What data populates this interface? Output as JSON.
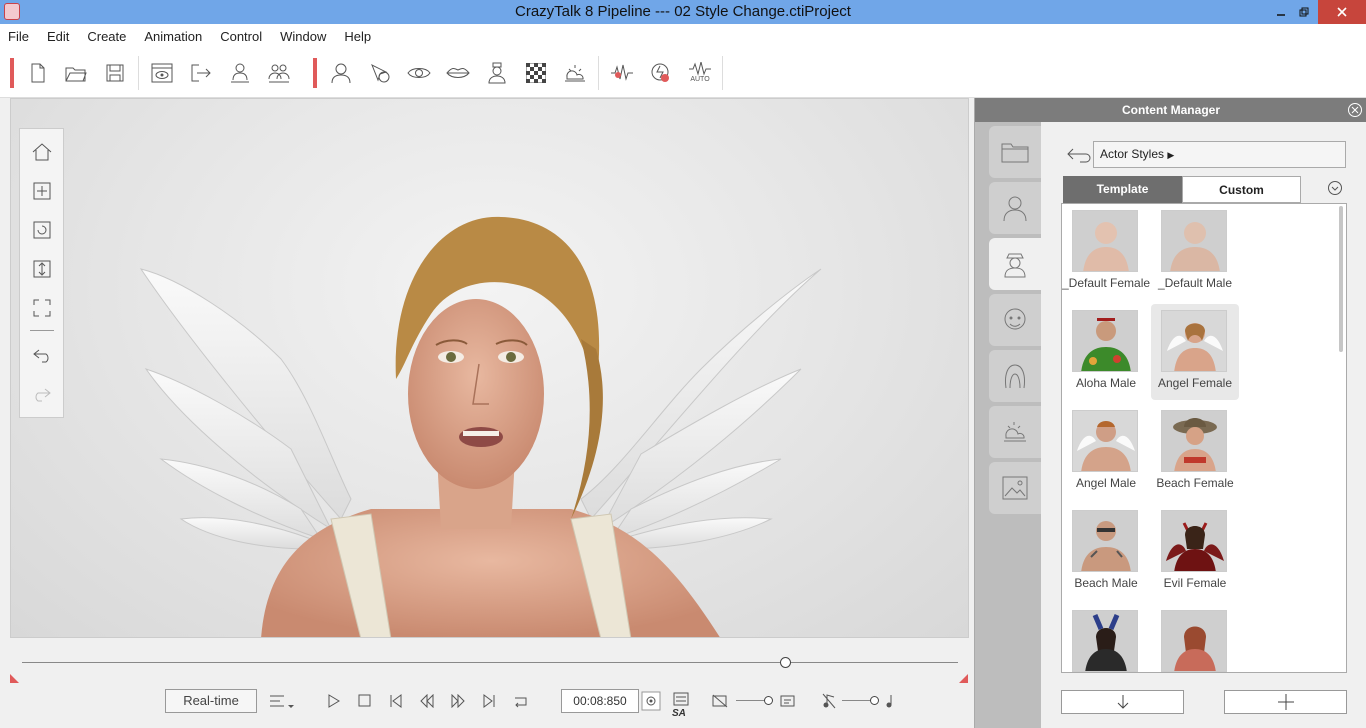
{
  "window": {
    "title": "CrazyTalk 8 Pipeline --- 02 Style Change.ctiProject"
  },
  "menu": [
    "File",
    "Edit",
    "Create",
    "Animation",
    "Control",
    "Window",
    "Help"
  ],
  "toolbar": {
    "icons": [
      "new-file-icon",
      "open-folder-icon",
      "save-icon",
      "preview-icon",
      "export-icon",
      "actor-icon",
      "crowd-icon",
      "head-icon",
      "select-icon",
      "eye-icon",
      "lips-icon",
      "avatar-bust-icon",
      "checker-icon",
      "weather-icon",
      "audio-wave-icon",
      "record-icon",
      "auto-icon"
    ],
    "auto_label": "AUTO"
  },
  "content_manager": {
    "title": "Content Manager",
    "path": "Actor Styles",
    "tabs": {
      "template": "Template",
      "custom": "Custom"
    },
    "items": [
      {
        "label": "_Default Female",
        "thumb": "default-female"
      },
      {
        "label": "_Default Male",
        "thumb": "default-male"
      },
      {
        "label": "Aloha Male",
        "thumb": "aloha-male"
      },
      {
        "label": "Angel Female",
        "thumb": "angel-female",
        "selected": true
      },
      {
        "label": "Angel Male",
        "thumb": "angel-male"
      },
      {
        "label": "Beach Female",
        "thumb": "beach-female"
      },
      {
        "label": "Beach Male",
        "thumb": "beach-male"
      },
      {
        "label": "Evil Female",
        "thumb": "evil-female"
      },
      {
        "label": "",
        "thumb": "bunny-female"
      },
      {
        "label": "",
        "thumb": "female-5"
      }
    ]
  },
  "playback": {
    "mode_label": "Real-time",
    "time": "00:08:850",
    "sa_label": "SA"
  },
  "colors": {
    "accent": "#e05a5a",
    "titlebar": "#70a6e8",
    "panel_header": "#7c7c7c"
  }
}
